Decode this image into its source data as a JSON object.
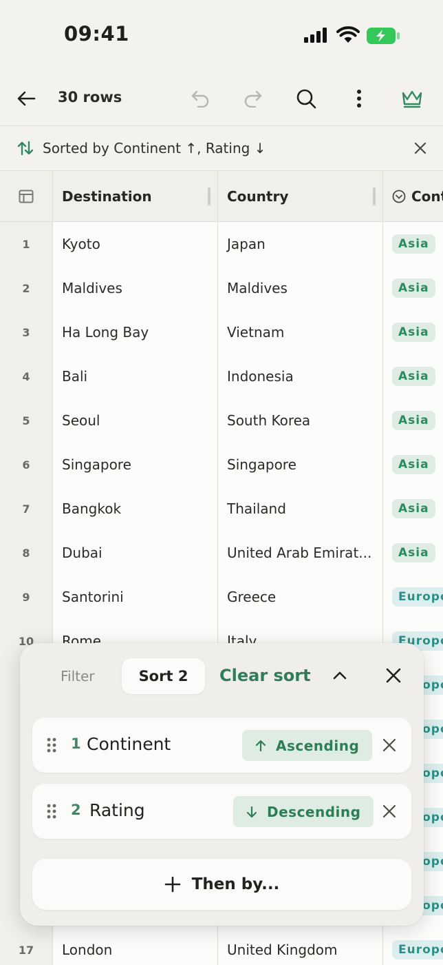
{
  "status": {
    "time": "09:41"
  },
  "toolbar": {
    "rows_label": "30 rows"
  },
  "sortbar": {
    "text": "Sorted by Continent ↑, Rating ↓"
  },
  "grid": {
    "headers": {
      "destination": "Destination",
      "country": "Country",
      "continent": "Cont"
    },
    "rows": [
      {
        "num": "1",
        "destination": "Kyoto",
        "country": "Japan",
        "continent": "Asia"
      },
      {
        "num": "2",
        "destination": "Maldives",
        "country": "Maldives",
        "continent": "Asia"
      },
      {
        "num": "3",
        "destination": "Ha Long Bay",
        "country": "Vietnam",
        "continent": "Asia"
      },
      {
        "num": "4",
        "destination": "Bali",
        "country": "Indonesia",
        "continent": "Asia"
      },
      {
        "num": "5",
        "destination": "Seoul",
        "country": "South Korea",
        "continent": "Asia"
      },
      {
        "num": "6",
        "destination": "Singapore",
        "country": "Singapore",
        "continent": "Asia"
      },
      {
        "num": "7",
        "destination": "Bangkok",
        "country": "Thailand",
        "continent": "Asia"
      },
      {
        "num": "8",
        "destination": "Dubai",
        "country": "United Arab Emirat...",
        "continent": "Asia"
      },
      {
        "num": "9",
        "destination": "Santorini",
        "country": "Greece",
        "continent": "Europe"
      },
      {
        "num": "10",
        "destination": "Rome",
        "country": "Italy",
        "continent": "Europe"
      },
      {
        "num": "17",
        "destination": "London",
        "country": "United Kingdom",
        "continent": "Europe"
      }
    ]
  },
  "sort_panel": {
    "tab_filter": "Filter",
    "tab_sort": "Sort 2",
    "clear_sort": "Clear sort",
    "rules": [
      {
        "index": "1",
        "field": "Continent",
        "direction": "Ascending"
      },
      {
        "index": "2",
        "field": "Rating",
        "direction": "Descending"
      }
    ],
    "then_by": "Then by..."
  },
  "colors": {
    "accent": "#2f7d58",
    "tag_asia_bg": "#dfece3",
    "tag_europe_bg": "#dcefee",
    "battery": "#34c759"
  },
  "icons": [
    "back-arrow-icon",
    "undo-icon",
    "redo-icon",
    "search-icon",
    "more-vertical-icon",
    "crown-icon",
    "sort-arrows-icon",
    "close-icon",
    "table-icon",
    "dropdown-circle-icon",
    "drag-handle-icon",
    "arrow-up-icon",
    "arrow-down-icon",
    "chevron-up-icon",
    "plus-icon"
  ]
}
